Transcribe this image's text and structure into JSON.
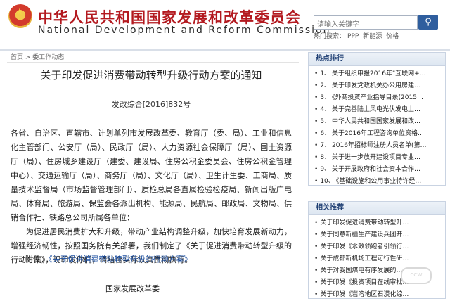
{
  "header": {
    "site_name_cn": "中华人民共和国国家发展和改革委员会",
    "site_name_en": "National Development and Reform Commission",
    "search_placeholder": "请输入关键字",
    "search_button_icon": "search-icon",
    "hot_label": "热门搜索：",
    "hot_words": [
      "PPP",
      "新能源",
      "价格"
    ]
  },
  "breadcrumb": "首页 > 委工作动态",
  "article": {
    "title": "关于印发促进消费带动转型升级行动方案的通知",
    "doc_number": "发改综合[2016]832号",
    "recipients": "各省、自治区、直辖市、计划单列市发展改革委、教育厅（委、局）、工业和信息化主管部门、公安厅（局）、民政厅（局）、人力资源社会保障厅（局）、国土资源厅（局）、住房城乡建设厅（建委、建设局、住房公积金委员会、住房公积金管理中心）、交通运输厅（局）、商务厅（局）、文化厅（局）、卫生计生委、工商局、质量技术监督局（市场监督管理部门）、质检总局各直属检验检疫局、新闻出版广电局、体育局、旅游局、保监会各派出机构、能源局、民航局、邮政局、文物局、供销合作社、铁路总公司所属各单位：",
    "paragraph": "为促进居民消费扩大和升级，带动产业结构调整升级，加快培育发展新动力，增强经济韧性，按照国务院有关部署，我们制定了《关于促进消费带动转型升级的行动方案》，现印发你们，请结合实际认真贯彻执行。",
    "attachment_label": "附件：",
    "attachment_link": "《关于促进消费带动转型升级的行动方案》",
    "signature": "国家发展改革委"
  },
  "hot_ranking": {
    "title": "热点排行",
    "items": [
      "关于组织申报2016年\"互联网+…",
      "关于印发党政机关办公用房建…",
      "《外商投资产业指导目录(2015…",
      "关于完善陆上风电光伏发电上…",
      "中华人民共和国国家发展和改…",
      "关于2016年工程咨询单位资格…",
      "2016年招标师注册人员名单(第…",
      "关于进一步放开建设项目专业…",
      "关于开展政府和社会资本合作…",
      "《基础设施和公用事业特许经…"
    ]
  },
  "related": {
    "title": "相关推荐",
    "items": [
      "关于印发促进消费带动转型升…",
      "关于同意新疆生产建设兵团开…",
      "关于印发《水效领跑者引领行…",
      "关于成都新机场工程可行性研…",
      "关于对我国煤电有序发展的…",
      "关于印发《投资项目在线审批…",
      "关于印发《岩溶地区石漠化综…"
    ]
  },
  "watermark_text": "ccw"
}
